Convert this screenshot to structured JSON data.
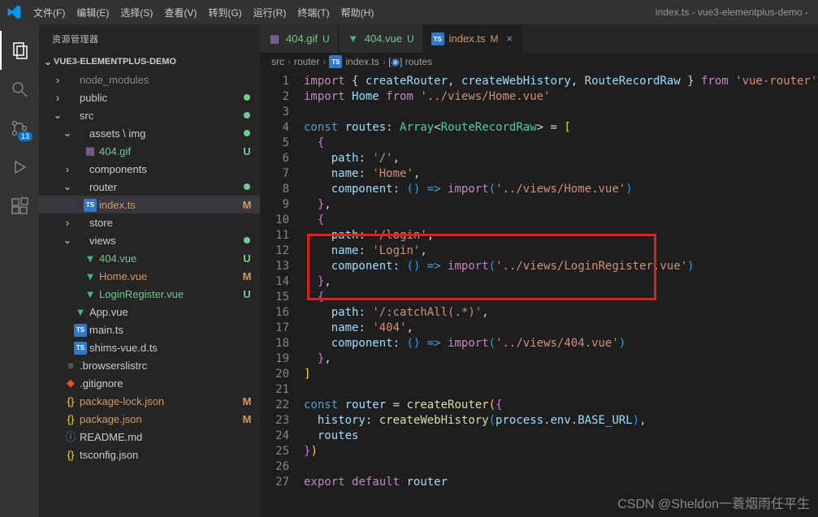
{
  "window_title": "index.ts - vue3-elementplus-demo -",
  "menu": [
    "文件(F)",
    "编辑(E)",
    "选择(S)",
    "查看(V)",
    "转到(G)",
    "运行(R)",
    "终端(T)",
    "帮助(H)"
  ],
  "activity_badge": "13",
  "sidebar": {
    "title": "资源管理器",
    "project": "VUE3-ELEMENTPLUS-DEMO",
    "tree": [
      {
        "indent": 1,
        "chev": ">",
        "icon": "folder",
        "label": "node_modules",
        "color": "#888"
      },
      {
        "indent": 1,
        "chev": ">",
        "icon": "folder",
        "label": "public",
        "dot": true
      },
      {
        "indent": 1,
        "chev": "v",
        "icon": "folder",
        "label": "src",
        "dot": true
      },
      {
        "indent": 2,
        "chev": "v",
        "icon": "folder",
        "label": "assets \\ img",
        "dot": true
      },
      {
        "indent": 3,
        "chev": "",
        "icon": "img",
        "label": "404.gif",
        "status": "U",
        "gitcls": "git-u"
      },
      {
        "indent": 2,
        "chev": ">",
        "icon": "folder",
        "label": "components"
      },
      {
        "indent": 2,
        "chev": "v",
        "icon": "folder",
        "label": "router",
        "dot": true
      },
      {
        "indent": 3,
        "chev": "",
        "icon": "ts",
        "label": "index.ts",
        "status": "M",
        "gitcls": "git-m",
        "selected": true
      },
      {
        "indent": 2,
        "chev": ">",
        "icon": "folder",
        "label": "store"
      },
      {
        "indent": 2,
        "chev": "v",
        "icon": "folder",
        "label": "views",
        "dot": true
      },
      {
        "indent": 3,
        "chev": "",
        "icon": "vue",
        "label": "404.vue",
        "status": "U",
        "gitcls": "git-u"
      },
      {
        "indent": 3,
        "chev": "",
        "icon": "vue",
        "label": "Home.vue",
        "status": "M",
        "gitcls": "git-m"
      },
      {
        "indent": 3,
        "chev": "",
        "icon": "vue",
        "label": "LoginRegister.vue",
        "status": "U",
        "gitcls": "git-u"
      },
      {
        "indent": 2,
        "chev": "",
        "icon": "vue",
        "label": "App.vue"
      },
      {
        "indent": 2,
        "chev": "",
        "icon": "ts",
        "label": "main.ts"
      },
      {
        "indent": 2,
        "chev": "",
        "icon": "ts",
        "label": "shims-vue.d.ts"
      },
      {
        "indent": 1,
        "chev": "",
        "icon": "cfg",
        "label": ".browserslistrc"
      },
      {
        "indent": 1,
        "chev": "",
        "icon": "git",
        "label": ".gitignore"
      },
      {
        "indent": 1,
        "chev": "",
        "icon": "json",
        "label": "package-lock.json",
        "status": "M",
        "gitcls": "git-m"
      },
      {
        "indent": 1,
        "chev": "",
        "icon": "json",
        "label": "package.json",
        "status": "M",
        "gitcls": "git-m"
      },
      {
        "indent": 1,
        "chev": "",
        "icon": "md",
        "label": "README.md"
      },
      {
        "indent": 1,
        "chev": "",
        "icon": "json",
        "label": "tsconfig.json"
      }
    ]
  },
  "tabs": [
    {
      "icon": "img",
      "label": "404.gif",
      "status": "U",
      "statcls": "git-u"
    },
    {
      "icon": "vue",
      "label": "404.vue",
      "status": "U",
      "statcls": "git-u"
    },
    {
      "icon": "ts",
      "label": "index.ts",
      "status": "M",
      "statcls": "git-m",
      "active": true,
      "close": true
    }
  ],
  "breadcrumb": [
    "src",
    "router",
    "index.ts",
    "routes"
  ],
  "bc_icons": [
    "",
    "",
    "ts",
    "var"
  ],
  "code_lines": [
    "<span class='k'>import</span> <span class='pn'>{</span> <span class='var'>createRouter</span><span class='pn'>,</span> <span class='var'>createWebHistory</span><span class='pn'>,</span> <span class='var'>RouteRecordRaw</span> <span class='pn'>}</span> <span class='k'>from</span> <span class='str'>'vue-router'</span>",
    "<span class='k'>import</span> <span class='var'>Home</span> <span class='k'>from</span> <span class='str'>'../views/Home.vue'</span>",
    "",
    "<span class='kb'>const</span> <span class='var'>routes</span><span class='pn'>:</span> <span class='ty'>Array</span><span class='pn'>&lt;</span><span class='ty'>RouteRecordRaw</span><span class='pn'>&gt;</span> <span class='op'>=</span> <span class='brk'>[</span>",
    "  <span class='brk2'>{</span>",
    "    <span class='var'>path</span><span class='pn'>:</span> <span class='str'>'/'</span><span class='pn'>,</span>",
    "    <span class='var'>name</span><span class='pn'>:</span> <span class='str'>'Home'</span><span class='pn'>,</span>",
    "    <span class='var'>component</span><span class='pn'>:</span> <span class='brk3'>()</span> <span class='kb'>=&gt;</span> <span class='k'>import</span><span class='brk3'>(</span><span class='str'>'../views/Home.vue'</span><span class='brk3'>)</span>",
    "  <span class='brk2'>}</span><span class='pn'>,</span>",
    "  <span class='brk2'>{</span>",
    "    <span class='var'>path</span><span class='pn'>:</span> <span class='str'>'/login'</span><span class='pn'>,</span>",
    "    <span class='var'>name</span><span class='pn'>:</span> <span class='str'>'Login'</span><span class='pn'>,</span>",
    "    <span class='var'>component</span><span class='pn'>:</span> <span class='brk3'>()</span> <span class='kb'>=&gt;</span> <span class='k'>import</span><span class='brk3'>(</span><span class='str'>'../views/LoginRegister.vue'</span><span class='brk3'>)</span>",
    "  <span class='brk2'>}</span><span class='pn'>,</span>",
    "  <span class='brk2'>{</span>",
    "    <span class='var'>path</span><span class='pn'>:</span> <span class='str'>'/:catchAll(.*)'</span><span class='pn'>,</span>",
    "    <span class='var'>name</span><span class='pn'>:</span> <span class='str'>'404'</span><span class='pn'>,</span>",
    "    <span class='var'>component</span><span class='pn'>:</span> <span class='brk3'>()</span> <span class='kb'>=&gt;</span> <span class='k'>import</span><span class='brk3'>(</span><span class='str'>'../views/404.vue'</span><span class='brk3'>)</span>",
    "  <span class='brk2'>}</span><span class='pn'>,</span>",
    "<span class='brk'>]</span>",
    "",
    "<span class='kb'>const</span> <span class='var'>router</span> <span class='op'>=</span> <span class='fn'>createRouter</span><span class='brk'>(</span><span class='brk2'>{</span>",
    "  <span class='var'>history</span><span class='pn'>:</span> <span class='fn'>createWebHistory</span><span class='brk3'>(</span><span class='var'>process</span><span class='pn'>.</span><span class='var'>env</span><span class='pn'>.</span><span class='var'>BASE_URL</span><span class='brk3'>)</span><span class='pn'>,</span>",
    "  <span class='var'>routes</span>",
    "<span class='brk2'>}</span><span class='brk'>)</span>",
    "",
    "<span class='k'>export</span> <span class='k'>default</span> <span class='var'>router</span>"
  ],
  "watermark": "CSDN @Sheldon一蓑烟雨任平生"
}
